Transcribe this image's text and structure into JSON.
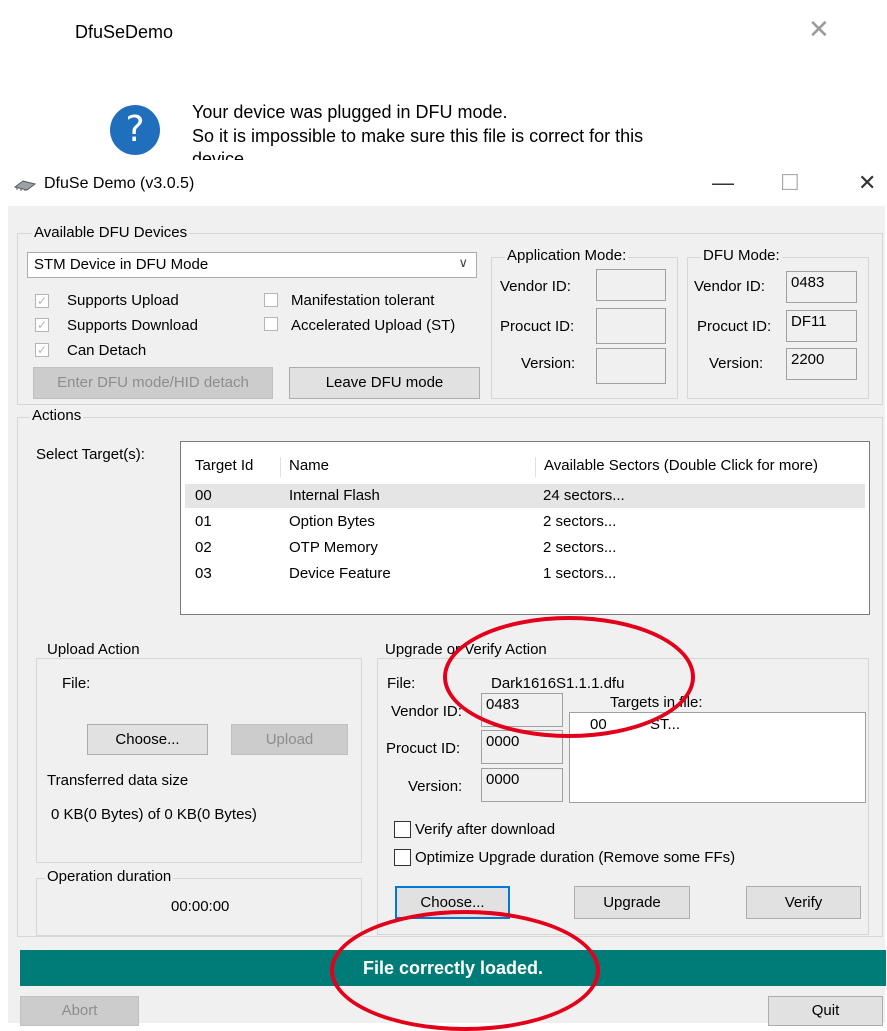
{
  "dialog": {
    "title": "DfuSeDemo",
    "close": "✕",
    "message_line1": "Your device was plugged in DFU mode.",
    "message_line2": "So it is impossible to make sure this file is correct for this",
    "message_line3": "device"
  },
  "window": {
    "title": "DfuSe Demo (v3.0.5)",
    "minimize": "—",
    "maximize": "☐",
    "close": "✕"
  },
  "devices": {
    "group_label": "Available DFU Devices",
    "selected": "STM Device in DFU Mode",
    "supports_upload": "Supports Upload",
    "supports_download": "Supports Download",
    "can_detach": "Can Detach",
    "manifestation_tolerant": "Manifestation tolerant",
    "accelerated_upload": "Accelerated Upload (ST)",
    "enter_dfu_btn": "Enter DFU mode/HID detach",
    "leave_dfu_btn": "Leave DFU mode"
  },
  "app_mode": {
    "label": "Application Mode:",
    "vendor_label": "Vendor ID:",
    "product_label": "Procuct ID:",
    "version_label": "Version:",
    "vendor": "",
    "product": "",
    "version": ""
  },
  "dfu_mode": {
    "label": "DFU Mode:",
    "vendor_label": "Vendor ID:",
    "product_label": "Procuct ID:",
    "version_label": "Version:",
    "vendor": "0483",
    "product": "DF11",
    "version": "2200"
  },
  "actions": {
    "group_label": "Actions",
    "select_targets_label": "Select Target(s):",
    "columns": [
      "Target Id",
      "Name",
      "Available Sectors (Double Click for more)"
    ],
    "targets": [
      {
        "id": "00",
        "name": "Internal Flash",
        "sectors": "24 sectors..."
      },
      {
        "id": "01",
        "name": "Option Bytes",
        "sectors": "2 sectors..."
      },
      {
        "id": "02",
        "name": "OTP Memory",
        "sectors": "2 sectors..."
      },
      {
        "id": "03",
        "name": "Device Feature",
        "sectors": "1 sectors..."
      }
    ]
  },
  "upload": {
    "group_label": "Upload Action",
    "file_label": "File:",
    "choose_btn": "Choose...",
    "upload_btn": "Upload"
  },
  "transfer": {
    "group_label": "Transferred data size",
    "value": "0 KB(0 Bytes) of 0 KB(0 Bytes)"
  },
  "duration": {
    "group_label": "Operation duration",
    "value": "00:00:00"
  },
  "upgrade": {
    "group_label": "Upgrade or Verify Action",
    "file_label": "File:",
    "file_value": "Dark1616S1.1.1.dfu",
    "vendor_label": "Vendor ID:",
    "product_label": "Procuct ID:",
    "version_label": "Version:",
    "vendor": "0483",
    "product": "0000",
    "version": "0000",
    "targets_label": "Targets in file:",
    "targets_row_id": "00",
    "targets_row_name": "ST...",
    "verify_after": "Verify after download",
    "optimize": "Optimize Upgrade duration (Remove some FFs)",
    "choose_btn": "Choose...",
    "upgrade_btn": "Upgrade",
    "verify_btn": "Verify"
  },
  "status": {
    "text": "File correctly loaded."
  },
  "footer": {
    "abort_btn": "Abort",
    "quit_btn": "Quit"
  },
  "colors": {
    "status_bg": "#007c78",
    "annotation": "#e3001b",
    "info_icon": "#1f6fbd"
  }
}
